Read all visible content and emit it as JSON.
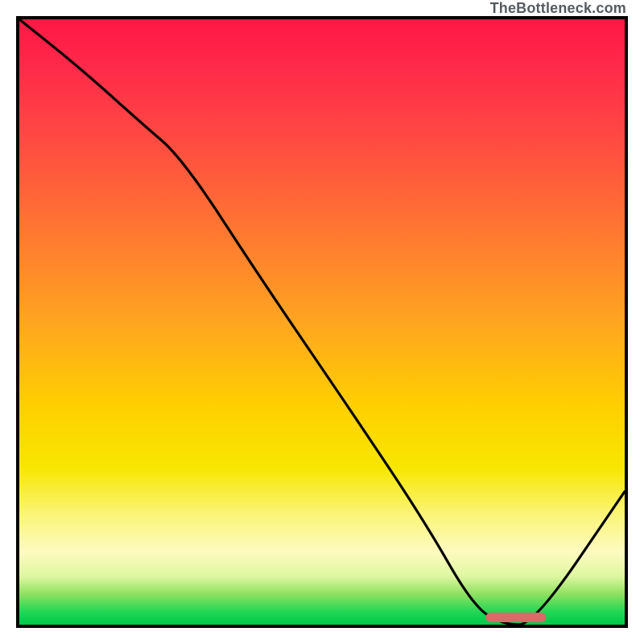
{
  "attribution": "TheBottleneck.com",
  "chart_data": {
    "type": "line",
    "title": "",
    "xlabel": "",
    "ylabel": "",
    "xlim": [
      0,
      100
    ],
    "ylim": [
      0,
      100
    ],
    "grid": false,
    "series": [
      {
        "name": "bottleneck-curve",
        "x": [
          0,
          10,
          20,
          27,
          40,
          55,
          67,
          75,
          80,
          85,
          100
        ],
        "y": [
          100,
          92,
          83,
          77,
          57,
          35,
          17,
          3,
          0,
          0,
          22
        ]
      }
    ],
    "marker": {
      "name": "optimal-range",
      "x_start": 77,
      "x_end": 87,
      "y": 1.2
    },
    "background": {
      "description": "vertical gradient red→orange→yellow→pale-yellow→green representing bottleneck severity",
      "stops": [
        {
          "pos": 0,
          "color": "#ff1744"
        },
        {
          "pos": 22,
          "color": "#ff5040"
        },
        {
          "pos": 50,
          "color": "#ffa520"
        },
        {
          "pos": 74,
          "color": "#f7e600"
        },
        {
          "pos": 88,
          "color": "#fdfbc0"
        },
        {
          "pos": 100,
          "color": "#00c84a"
        }
      ]
    }
  }
}
